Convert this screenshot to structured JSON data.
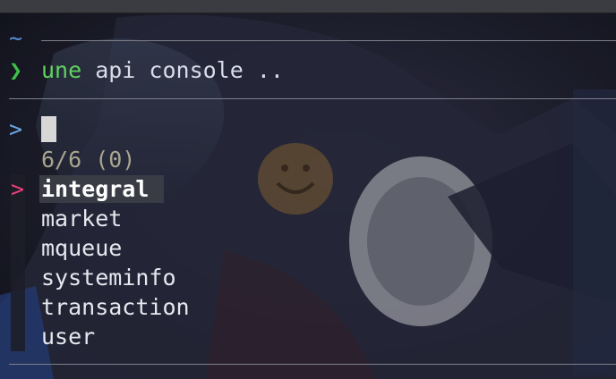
{
  "shell": {
    "cwd": "~",
    "prompt_symbol": "❯",
    "command_bin": "une",
    "command_args": " api console .."
  },
  "fzf": {
    "prompt": ">",
    "query": "",
    "count": "6/6 (0)",
    "pointer": ">",
    "items": [
      "integral",
      "market",
      "mqueue",
      "systeminfo",
      "transaction",
      "user"
    ],
    "selected_index": 0
  },
  "colors": {
    "tilde": "#5a8fd6",
    "prompt_arrow": "#3fbf4a",
    "command": "#5fd35f",
    "pointer": "#e8407a",
    "count": "#a9a590"
  }
}
